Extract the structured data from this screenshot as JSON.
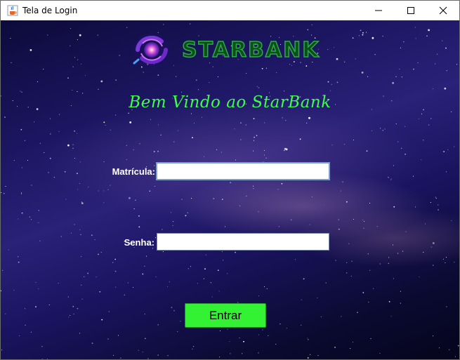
{
  "window": {
    "title": "Tela de Login",
    "app_icon": "java-cup-icon",
    "controls": [
      "minimize-icon",
      "maximize-icon",
      "close-icon"
    ]
  },
  "logo": {
    "text": "STARBANK",
    "icon": "galaxy-spiral-icon"
  },
  "welcome": "Bem Vindo ao StarBank",
  "form": {
    "matricula_label": "Matrícula:",
    "matricula_value": "",
    "senha_label": "Senha:",
    "senha_value": "",
    "submit_label": "Entrar"
  },
  "colors": {
    "accent_green": "#33f233",
    "welcome_green": "#3dff4a",
    "logo_green": "#2fa848",
    "background_space": "#1d1764"
  }
}
